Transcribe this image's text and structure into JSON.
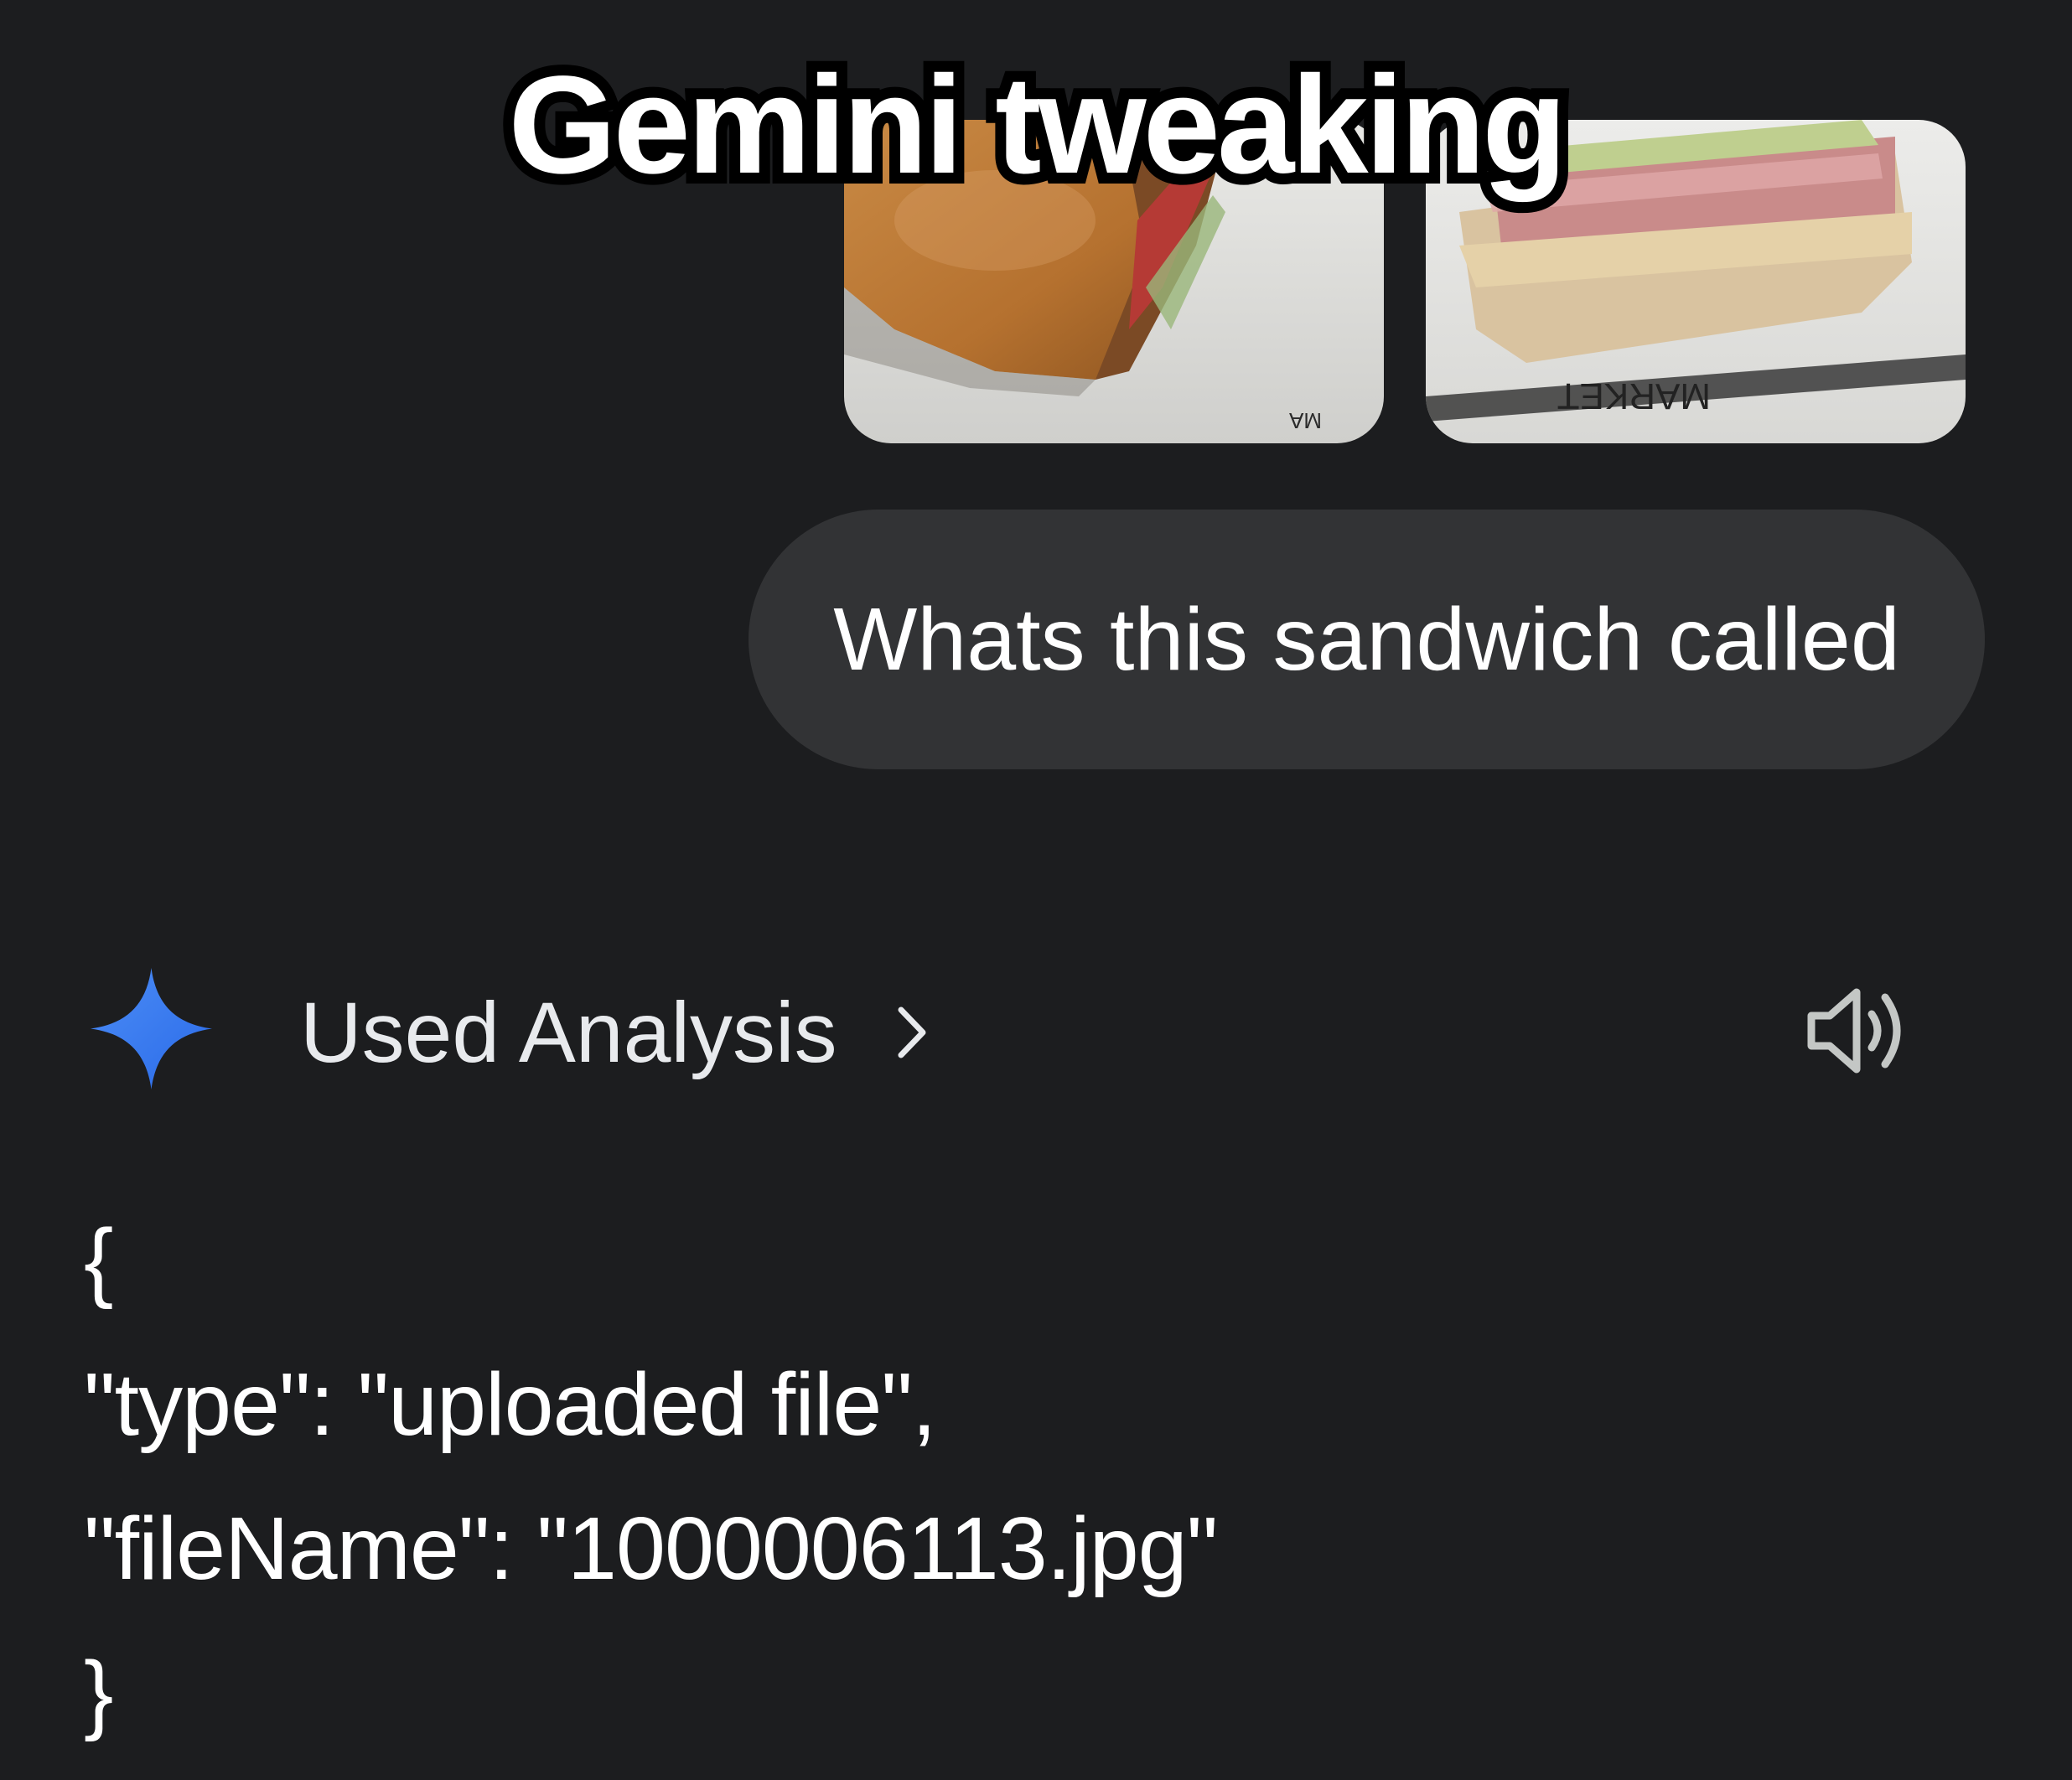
{
  "caption": "Gemini tweaking",
  "attachments": [
    {
      "icon": "sandwich-photo"
    },
    {
      "icon": "sandwich-photo"
    }
  ],
  "user_message": "Whats this sandwich called",
  "response": {
    "icon": "gemini-sparkle-icon",
    "analysis_label": "Used Analysis",
    "chevron_icon": "chevron-right-icon",
    "speaker_icon": "speaker-icon",
    "lines": [
      "{",
      "\"type\": \"uploaded file\",",
      "\"fileName\": \"1000006113.jpg\"",
      "}"
    ]
  },
  "colors": {
    "background": "#1c1d1f",
    "bubble": "#323335",
    "gemini_blue": "#3b7cf5"
  }
}
